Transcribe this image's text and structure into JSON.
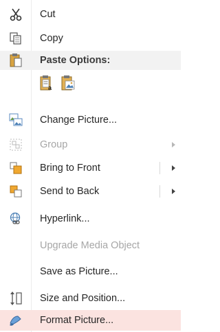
{
  "menu": {
    "cut": "Cut",
    "copy": "Copy",
    "paste_options_header": "Paste Options:",
    "paste_buttons": [
      "keep-text-only-paste-icon",
      "picture-paste-icon"
    ],
    "change_picture": "Change Picture...",
    "group": "Group",
    "bring_to_front": "Bring to Front",
    "send_to_back": "Send to Back",
    "hyperlink": "Hyperlink...",
    "upgrade_media_object": "Upgrade Media Object",
    "save_as_picture": "Save as Picture...",
    "size_and_position": "Size and Position...",
    "format_picture": "Format Picture..."
  },
  "colors": {
    "hover_background": "#fbe3e0",
    "section_header_background": "#f2f2f2",
    "disabled_text": "#a6a6a6"
  }
}
